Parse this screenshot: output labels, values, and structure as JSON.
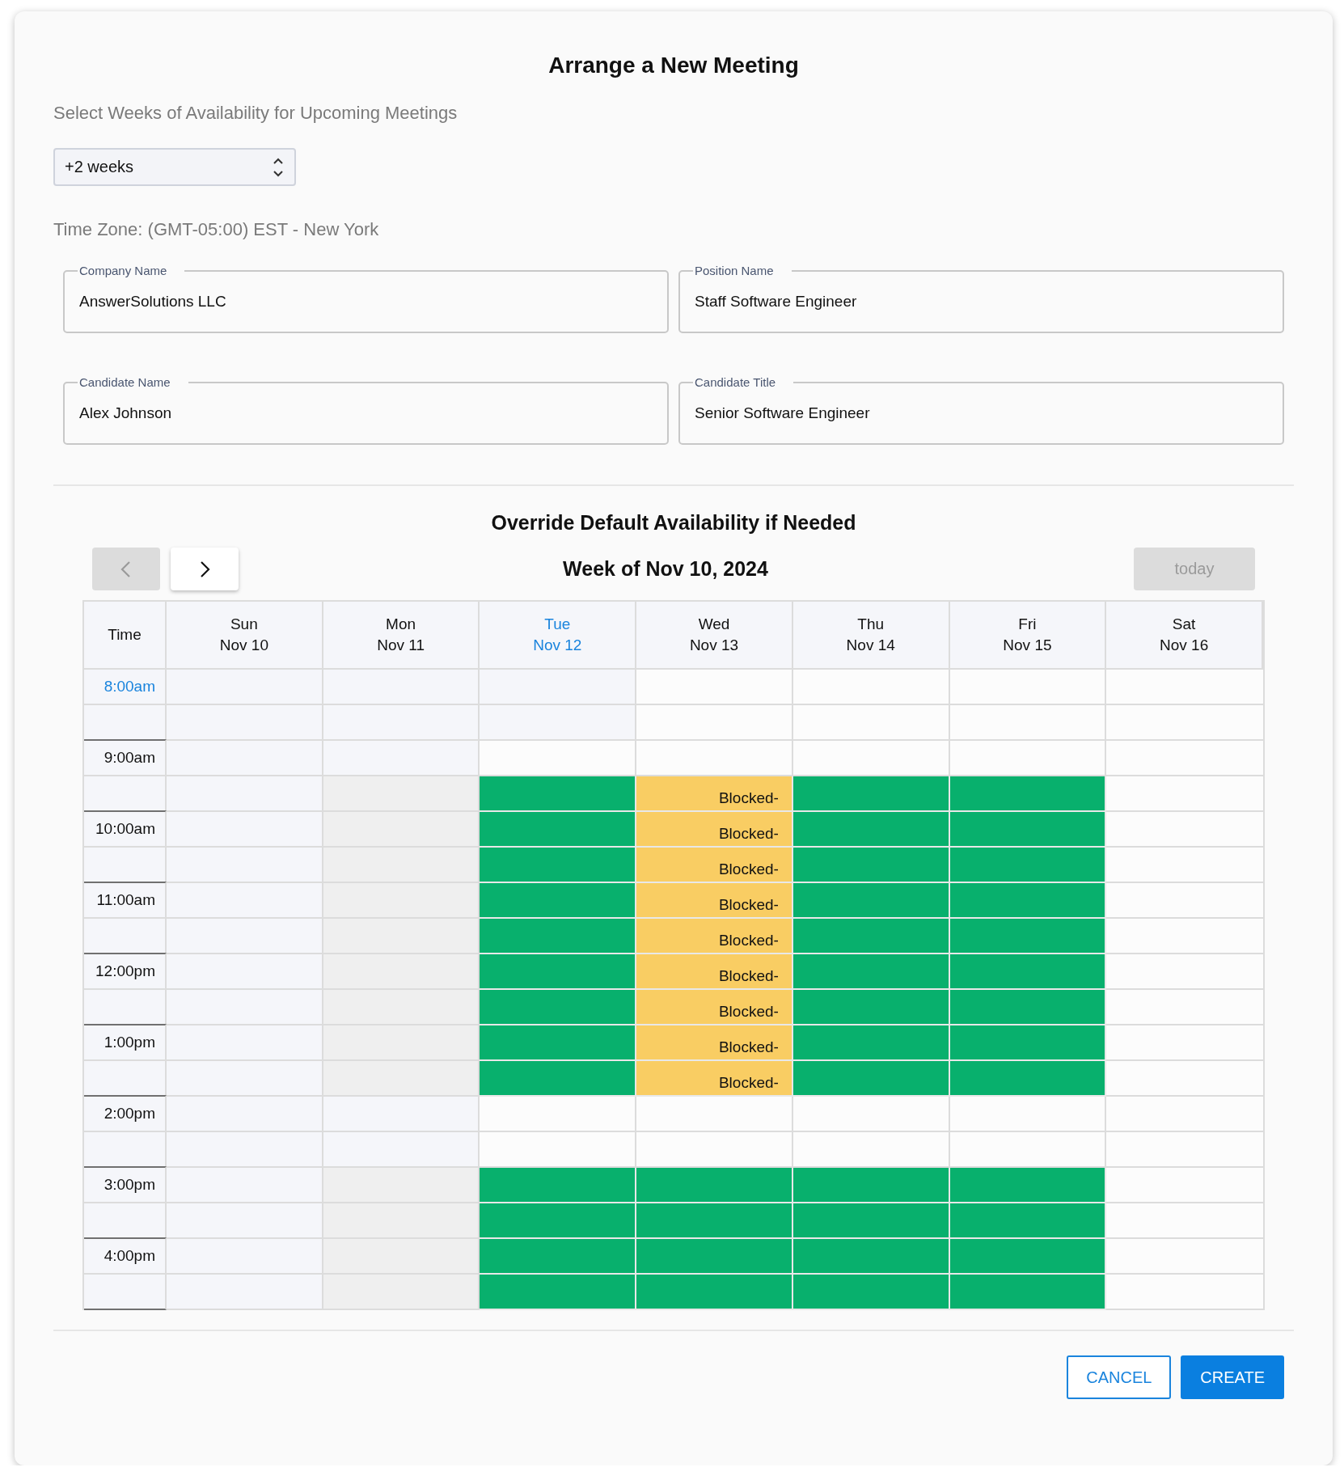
{
  "dialog": {
    "title": "Arrange a New Meeting"
  },
  "weeks": {
    "label": "Select Weeks of Availability for Upcoming Meetings",
    "value": "+2 weeks"
  },
  "timezone": "Time Zone: (GMT-05:00) EST - New York",
  "fields": [
    {
      "label": "Company Name",
      "value": "AnswerSolutions LLC"
    },
    {
      "label": "Position Name",
      "value": "Staff Software Engineer"
    },
    {
      "label": "Candidate Name",
      "value": "Alex Johnson"
    },
    {
      "label": "Candidate Title",
      "value": "Senior Software Engineer"
    }
  ],
  "calendar": {
    "title": "Override Default Availability if Needed",
    "prev": {
      "disabled": true
    },
    "next": {
      "disabled": false
    },
    "week_title": "Week of Nov 10, 2024",
    "today_button": {
      "label": "today",
      "disabled": true
    },
    "time_header": "Time",
    "days": [
      {
        "name": "Sun",
        "date": "Nov 10",
        "today": false
      },
      {
        "name": "Mon",
        "date": "Nov 11",
        "today": false
      },
      {
        "name": "Tue",
        "date": "Nov 12",
        "today": true
      },
      {
        "name": "Wed",
        "date": "Nov 13",
        "today": false
      },
      {
        "name": "Thu",
        "date": "Nov 14",
        "today": false
      },
      {
        "name": "Fri",
        "date": "Nov 15",
        "today": false
      },
      {
        "name": "Sat",
        "date": "Nov 16",
        "today": false
      }
    ],
    "rows": [
      {
        "time": "8:00am",
        "current": true,
        "cells": [
          {
            "kind": "past"
          },
          {
            "kind": "past"
          },
          {
            "kind": "past"
          },
          {
            "kind": "open"
          },
          {
            "kind": "open"
          },
          {
            "kind": "open"
          },
          {
            "kind": "open"
          }
        ]
      },
      {
        "cells": [
          {
            "kind": "past"
          },
          {
            "kind": "past"
          },
          {
            "kind": "past"
          },
          {
            "kind": "open"
          },
          {
            "kind": "open"
          },
          {
            "kind": "open"
          },
          {
            "kind": "open"
          }
        ]
      },
      {
        "time": "9:00am",
        "current": false,
        "cells": [
          {
            "kind": "past"
          },
          {
            "kind": "past"
          },
          {
            "kind": "open"
          },
          {
            "kind": "open"
          },
          {
            "kind": "open"
          },
          {
            "kind": "open"
          },
          {
            "kind": "open"
          }
        ]
      },
      {
        "cells": [
          {
            "kind": "past"
          },
          {
            "kind": "closed"
          },
          {
            "kind": "available"
          },
          {
            "kind": "blocked",
            "label": "Blocked-"
          },
          {
            "kind": "available"
          },
          {
            "kind": "available"
          },
          {
            "kind": "open"
          }
        ]
      },
      {
        "time": "10:00am",
        "current": false,
        "cells": [
          {
            "kind": "past"
          },
          {
            "kind": "closed"
          },
          {
            "kind": "available"
          },
          {
            "kind": "blocked",
            "label": "Blocked-"
          },
          {
            "kind": "available"
          },
          {
            "kind": "available"
          },
          {
            "kind": "open"
          }
        ]
      },
      {
        "cells": [
          {
            "kind": "past"
          },
          {
            "kind": "closed"
          },
          {
            "kind": "available"
          },
          {
            "kind": "blocked",
            "label": "Blocked-"
          },
          {
            "kind": "available"
          },
          {
            "kind": "available"
          },
          {
            "kind": "open"
          }
        ]
      },
      {
        "time": "11:00am",
        "current": false,
        "cells": [
          {
            "kind": "past"
          },
          {
            "kind": "closed"
          },
          {
            "kind": "available"
          },
          {
            "kind": "blocked",
            "label": "Blocked-"
          },
          {
            "kind": "available"
          },
          {
            "kind": "available"
          },
          {
            "kind": "open"
          }
        ]
      },
      {
        "cells": [
          {
            "kind": "past"
          },
          {
            "kind": "closed"
          },
          {
            "kind": "available"
          },
          {
            "kind": "blocked",
            "label": "Blocked-"
          },
          {
            "kind": "available"
          },
          {
            "kind": "available"
          },
          {
            "kind": "open"
          }
        ]
      },
      {
        "time": "12:00pm",
        "current": false,
        "cells": [
          {
            "kind": "past"
          },
          {
            "kind": "closed"
          },
          {
            "kind": "available"
          },
          {
            "kind": "blocked",
            "label": "Blocked-"
          },
          {
            "kind": "available"
          },
          {
            "kind": "available"
          },
          {
            "kind": "open"
          }
        ]
      },
      {
        "cells": [
          {
            "kind": "past"
          },
          {
            "kind": "closed"
          },
          {
            "kind": "available"
          },
          {
            "kind": "blocked",
            "label": "Blocked-"
          },
          {
            "kind": "available"
          },
          {
            "kind": "available"
          },
          {
            "kind": "open"
          }
        ]
      },
      {
        "time": "1:00pm",
        "current": false,
        "cells": [
          {
            "kind": "past"
          },
          {
            "kind": "closed"
          },
          {
            "kind": "available"
          },
          {
            "kind": "blocked",
            "label": "Blocked-"
          },
          {
            "kind": "available"
          },
          {
            "kind": "available"
          },
          {
            "kind": "open"
          }
        ]
      },
      {
        "cells": [
          {
            "kind": "past"
          },
          {
            "kind": "closed"
          },
          {
            "kind": "available"
          },
          {
            "kind": "blocked",
            "label": "Blocked-"
          },
          {
            "kind": "available"
          },
          {
            "kind": "available"
          },
          {
            "kind": "open"
          }
        ]
      },
      {
        "time": "2:00pm",
        "current": false,
        "cells": [
          {
            "kind": "past"
          },
          {
            "kind": "past"
          },
          {
            "kind": "open"
          },
          {
            "kind": "open"
          },
          {
            "kind": "open"
          },
          {
            "kind": "open"
          },
          {
            "kind": "open"
          }
        ]
      },
      {
        "cells": [
          {
            "kind": "past"
          },
          {
            "kind": "past"
          },
          {
            "kind": "open"
          },
          {
            "kind": "open"
          },
          {
            "kind": "open"
          },
          {
            "kind": "open"
          },
          {
            "kind": "open"
          }
        ]
      },
      {
        "time": "3:00pm",
        "current": false,
        "cells": [
          {
            "kind": "past"
          },
          {
            "kind": "closed"
          },
          {
            "kind": "available"
          },
          {
            "kind": "available"
          },
          {
            "kind": "available"
          },
          {
            "kind": "available"
          },
          {
            "kind": "open"
          }
        ]
      },
      {
        "cells": [
          {
            "kind": "past"
          },
          {
            "kind": "closed"
          },
          {
            "kind": "available"
          },
          {
            "kind": "available"
          },
          {
            "kind": "available"
          },
          {
            "kind": "available"
          },
          {
            "kind": "open"
          }
        ]
      },
      {
        "time": "4:00pm",
        "current": false,
        "cells": [
          {
            "kind": "past"
          },
          {
            "kind": "closed"
          },
          {
            "kind": "available"
          },
          {
            "kind": "available"
          },
          {
            "kind": "available"
          },
          {
            "kind": "available"
          },
          {
            "kind": "open"
          }
        ]
      },
      {
        "cells": [
          {
            "kind": "past"
          },
          {
            "kind": "closed"
          },
          {
            "kind": "available"
          },
          {
            "kind": "available"
          },
          {
            "kind": "available"
          },
          {
            "kind": "available"
          },
          {
            "kind": "open"
          }
        ]
      }
    ]
  },
  "buttons": [
    {
      "label": "CANCEL",
      "kind": "outlined"
    },
    {
      "label": "CREATE",
      "kind": "primary"
    }
  ]
}
